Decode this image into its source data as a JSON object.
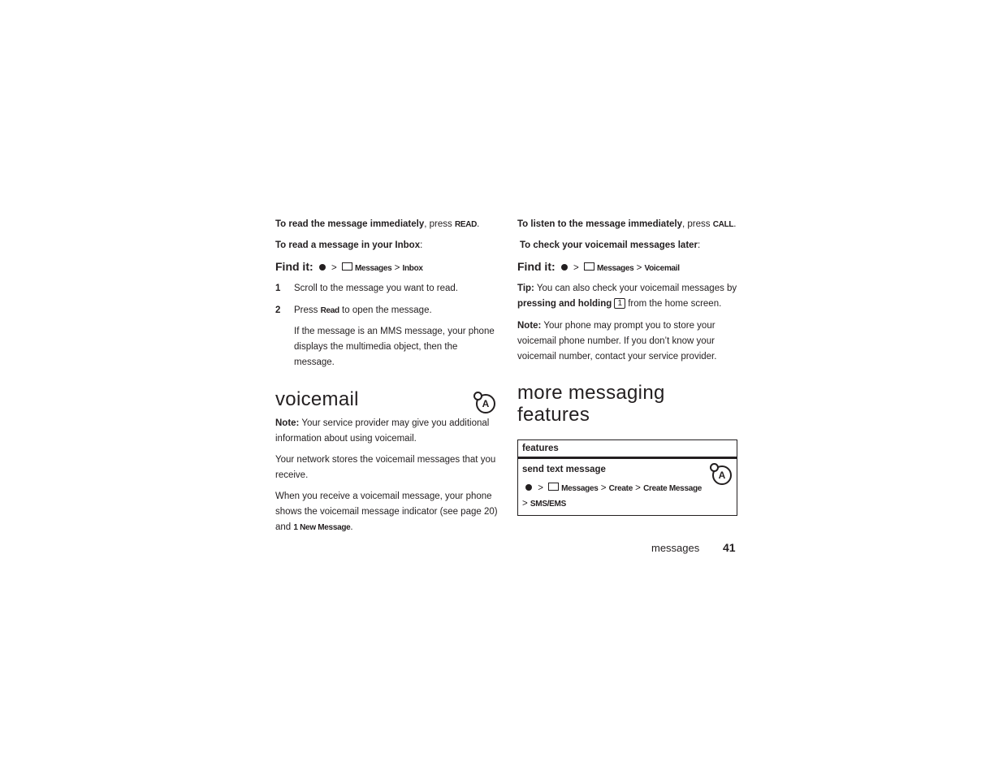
{
  "left": {
    "p1": {
      "bold": "To read the message immediately",
      "rest": ", press ",
      "key": "READ",
      "end": "."
    },
    "p2": {
      "bold": "To read a message in your Inbox",
      "end": ":"
    },
    "findit": {
      "label": "Find it:",
      "path": [
        "Messages",
        "Inbox"
      ]
    },
    "steps": [
      {
        "num": "1",
        "text": "Scroll to the message you want to read."
      },
      {
        "num": "2",
        "pre": "Press ",
        "key": "Read",
        "post": " to open the message."
      }
    ],
    "mms_lines": [
      "If the message is an MMS message, your phone",
      "displays the multimedia object, then the",
      "message."
    ],
    "voicemail_title": "voicemail",
    "note_label": "Note:",
    "note_lines": [
      " Your service provider may give you additional",
      "information about using voicemail."
    ],
    "network_lines": [
      "Your network stores the voicemail messages that you",
      "receive."
    ],
    "receive_lines": [
      "When you receive a voicemail message, your phone",
      "shows the voicemail message indicator (see page 20)",
      "and "
    ],
    "receive_key": "1 New Message",
    "receive_end": "."
  },
  "right": {
    "p1": {
      "bold": "To listen to the message immediately",
      "rest": ", press ",
      "key": "CALL",
      "end": "."
    },
    "p2": {
      "bold": "To check your voicemail messages later",
      "end": ":"
    },
    "findit": {
      "label": "Find it:",
      "path": [
        "Messages",
        "Voicemail"
      ]
    },
    "tip": {
      "label": "Tip:",
      "line1": " You can also check your voicemail messages by",
      "bold": "pressing and holding",
      "key": "1",
      "line2": " from the home screen."
    },
    "note": {
      "label": "Note:",
      "lines": [
        " Your phone may prompt you to store your",
        "voicemail phone number. If you don’t know your",
        "voicemail number, contact your service provider."
      ]
    },
    "title_lines": [
      "more messaging",
      "features"
    ],
    "table": {
      "header": "features",
      "row_title": "send text message",
      "path": [
        "Messages",
        "Create",
        "Create Message"
      ],
      "path2": "SMS/EMS"
    }
  },
  "footer": {
    "section": "messages",
    "page": "41"
  },
  "icons": {
    "nav": "nav-key-icon",
    "envelope": "envelope-icon",
    "feature": "network-feature-icon"
  }
}
